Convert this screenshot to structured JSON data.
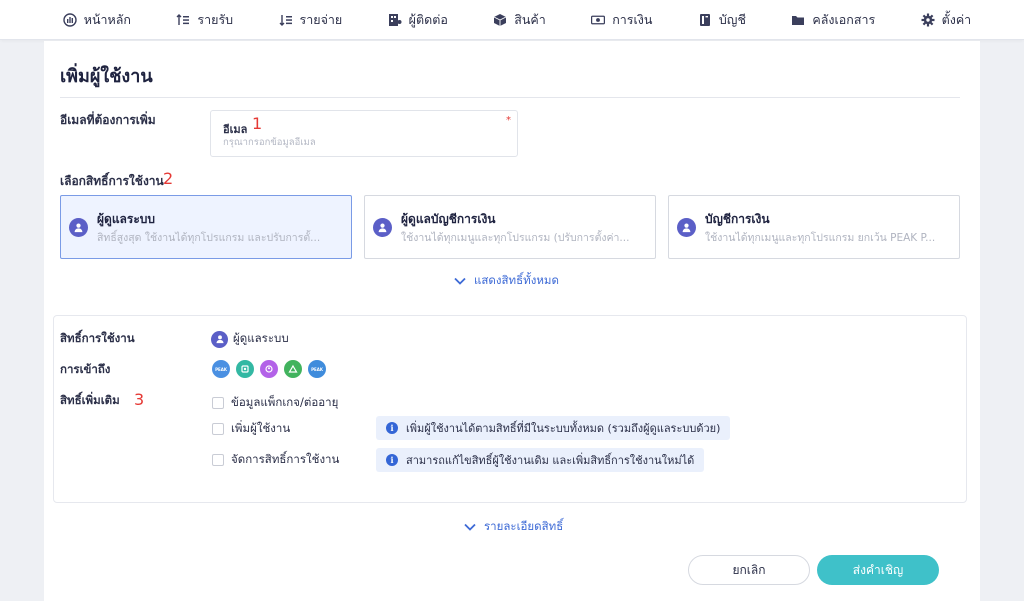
{
  "nav": {
    "items": [
      {
        "label": "หน้าหลัก",
        "icon": "dashboard-icon"
      },
      {
        "label": "รายรับ",
        "icon": "income-icon"
      },
      {
        "label": "รายจ่าย",
        "icon": "expense-icon"
      },
      {
        "label": "ผู้ติดต่อ",
        "icon": "contacts-icon"
      },
      {
        "label": "สินค้า",
        "icon": "box-icon"
      },
      {
        "label": "การเงิน",
        "icon": "money-icon"
      },
      {
        "label": "บัญชี",
        "icon": "ledger-icon"
      },
      {
        "label": "คลังเอกสาร",
        "icon": "folder-icon"
      },
      {
        "label": "ตั้งค่า",
        "icon": "gear-icon"
      }
    ]
  },
  "page": {
    "title": "เพิ่มผู้ใช้งาน"
  },
  "email_section": {
    "label": "อีเมลที่ต้องการเพิ่ม",
    "field_label": "อีเมล",
    "placeholder": "กรุณากรอกข้อมูลอีเมล",
    "required_mark": "*",
    "annotation": "1"
  },
  "role_section": {
    "label": "เลือกสิทธิ์การใช้งาน",
    "annotation": "2",
    "roles": [
      {
        "title": "ผู้ดูแลระบบ",
        "desc": "สิทธิ์สูงสุด ใช้งานได้ทุกโปรแกรม และปรับการตั้...",
        "selected": true
      },
      {
        "title": "ผู้ดูแลบัญชีการเงิน",
        "desc": "ใช้งานได้ทุกเมนูและทุกโปรแกรม (ปรับการตั้งค่า...",
        "selected": false
      },
      {
        "title": "บัญชีการเงิน",
        "desc": "ใช้งานได้ทุกเมนูและทุกโปรแกรม ยกเว้น PEAK P...",
        "selected": false
      }
    ],
    "show_all": "แสดงสิทธิ์ทั้งหมด"
  },
  "summary": {
    "role_label": "สิทธิ์การใช้งาน",
    "role_value": "ผู้ดูแลระบบ",
    "access_label": "การเข้าถึง",
    "apps": [
      "PEAK",
      "",
      "",
      "",
      "PEAK"
    ],
    "extra_label": "สิทธิ์เพิ่มเติม",
    "extra_annotation": "3",
    "checks": [
      {
        "label": "ข้อมูลแพ็กเกจ/ต่ออายุ",
        "checked": false,
        "info": ""
      },
      {
        "label": "เพิ่มผู้ใช้งาน",
        "checked": false,
        "info": "เพิ่มผู้ใช้งานได้ตามสิทธิ์ที่มีในระบบทั้งหมด (รวมถึงผู้ดูแลระบบด้วย)"
      },
      {
        "label": "จัดการสิทธิ์การใช้งาน",
        "checked": false,
        "info": "สามารถแก้ไขสิทธิ์ผู้ใช้งานเดิม และเพิ่มสิทธิ์การใช้งานใหม่ได้"
      }
    ]
  },
  "detail_link": "รายละเอียดสิทธิ์",
  "actions": {
    "cancel": "ยกเลิก",
    "invite": "ส่งคำเชิญ"
  },
  "colors": {
    "accent": "#3d6ad6",
    "invite_button": "#3fc1c9",
    "annotation": "#e53935",
    "avatar": "#5b5fc7"
  }
}
